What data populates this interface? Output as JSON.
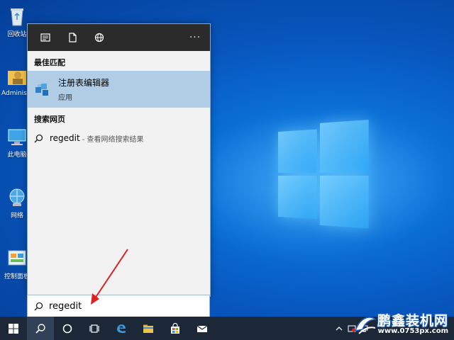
{
  "desktop": {
    "icons": [
      {
        "label": "回收站",
        "icon": "recycle-bin-icon"
      },
      {
        "label": "Administrator",
        "icon": "user-folder-icon"
      },
      {
        "label": "此电脑",
        "icon": "computer-icon"
      },
      {
        "label": "网络",
        "icon": "network-icon"
      },
      {
        "label": "控制面板",
        "icon": "control-panel-icon"
      }
    ]
  },
  "panel": {
    "top_icons": [
      "all-apps-icon",
      "documents-icon",
      "web-icon"
    ],
    "more": "···",
    "best_match_title": "最佳匹配",
    "best_match": {
      "name": "注册表编辑器",
      "type": "应用",
      "icon": "registry-editor-icon"
    },
    "web_title": "搜索网页",
    "web_result": {
      "term": "regedit",
      "desc": "- 查看网络搜索结果"
    }
  },
  "search": {
    "value": "regedit"
  },
  "taskbar": {
    "items": [
      "start-icon",
      "search-icon",
      "cortana-icon",
      "task-view-icon",
      "edge-icon",
      "file-explorer-icon",
      "store-icon",
      "mail-icon"
    ]
  },
  "watermark": {
    "title": "鹏鑫装机网",
    "url": "www.0753px.com"
  },
  "colors": {
    "accent": "#0a6fd6",
    "highlight": "#b1cde6",
    "arrow": "#e02020"
  }
}
